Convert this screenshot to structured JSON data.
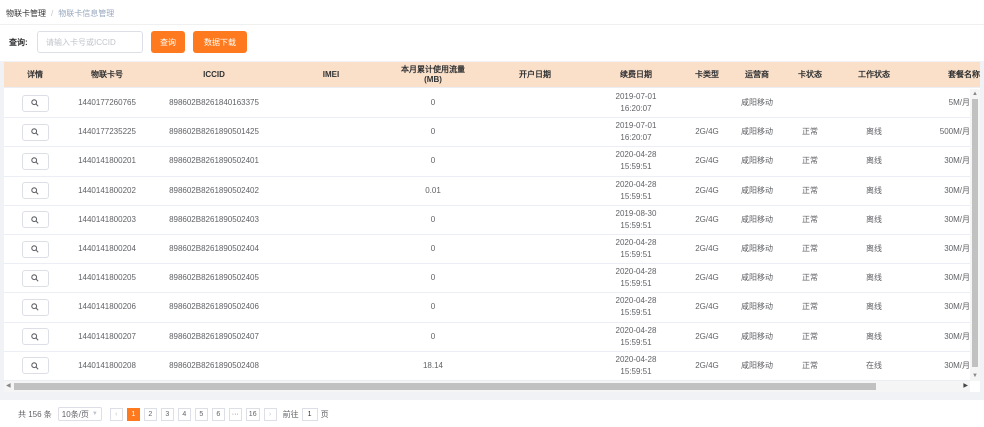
{
  "breadcrumb": {
    "items": [
      "物联卡管理",
      "物联卡信息管理"
    ],
    "separator": "/"
  },
  "search": {
    "label": "查询:",
    "placeholder": "请输入卡号或ICCID",
    "query_button": "查询",
    "download_button": "数据下载"
  },
  "colors": {
    "accent": "#ff7a1e",
    "header_bg": "#fae0c9"
  },
  "table": {
    "columns": [
      "详情",
      "物联卡号",
      "ICCID",
      "IMEI",
      "本月累计使用流量\n(MB)",
      "开户日期",
      "续费日期",
      "卡类型",
      "运营商",
      "卡状态",
      "工作状态",
      "套餐名称"
    ],
    "detail_icon": "search-icon",
    "rows": [
      {
        "card": "1440177260765",
        "iccid": "898602B8261840163375",
        "imei": "",
        "usage": "0",
        "open_date": "",
        "renew_date": "2019-07-01 16:20:07",
        "card_type": "",
        "operator": "咸阳移动",
        "card_status": "",
        "work_status": "",
        "package": "5M/月"
      },
      {
        "card": "1440177235225",
        "iccid": "898602B8261890501425",
        "imei": "",
        "usage": "0",
        "open_date": "",
        "renew_date": "2019-07-01 16:20:07",
        "card_type": "2G/4G",
        "operator": "咸阳移动",
        "card_status": "正常",
        "work_status": "离线",
        "package": "500M/月"
      },
      {
        "card": "1440141800201",
        "iccid": "898602B8261890502401",
        "imei": "",
        "usage": "0",
        "open_date": "",
        "renew_date": "2020-04-28 15:59:51",
        "card_type": "2G/4G",
        "operator": "咸阳移动",
        "card_status": "正常",
        "work_status": "离线",
        "package": "30M/月"
      },
      {
        "card": "1440141800202",
        "iccid": "898602B8261890502402",
        "imei": "",
        "usage": "0.01",
        "open_date": "",
        "renew_date": "2020-04-28 15:59:51",
        "card_type": "2G/4G",
        "operator": "咸阳移动",
        "card_status": "正常",
        "work_status": "离线",
        "package": "30M/月"
      },
      {
        "card": "1440141800203",
        "iccid": "898602B8261890502403",
        "imei": "",
        "usage": "0",
        "open_date": "",
        "renew_date": "2019-08-30 15:59:51",
        "card_type": "2G/4G",
        "operator": "咸阳移动",
        "card_status": "正常",
        "work_status": "离线",
        "package": "30M/月"
      },
      {
        "card": "1440141800204",
        "iccid": "898602B8261890502404",
        "imei": "",
        "usage": "0",
        "open_date": "",
        "renew_date": "2020-04-28 15:59:51",
        "card_type": "2G/4G",
        "operator": "咸阳移动",
        "card_status": "正常",
        "work_status": "离线",
        "package": "30M/月"
      },
      {
        "card": "1440141800205",
        "iccid": "898602B8261890502405",
        "imei": "",
        "usage": "0",
        "open_date": "",
        "renew_date": "2020-04-28 15:59:51",
        "card_type": "2G/4G",
        "operator": "咸阳移动",
        "card_status": "正常",
        "work_status": "离线",
        "package": "30M/月"
      },
      {
        "card": "1440141800206",
        "iccid": "898602B8261890502406",
        "imei": "",
        "usage": "0",
        "open_date": "",
        "renew_date": "2020-04-28 15:59:51",
        "card_type": "2G/4G",
        "operator": "咸阳移动",
        "card_status": "正常",
        "work_status": "离线",
        "package": "30M/月"
      },
      {
        "card": "1440141800207",
        "iccid": "898602B8261890502407",
        "imei": "",
        "usage": "0",
        "open_date": "",
        "renew_date": "2020-04-28 15:59:51",
        "card_type": "2G/4G",
        "operator": "咸阳移动",
        "card_status": "正常",
        "work_status": "离线",
        "package": "30M/月"
      },
      {
        "card": "1440141800208",
        "iccid": "898602B8261890502408",
        "imei": "",
        "usage": "18.14",
        "open_date": "",
        "renew_date": "2020-04-28 15:59:51",
        "card_type": "2G/4G",
        "operator": "咸阳移动",
        "card_status": "正常",
        "work_status": "在线",
        "package": "30M/月"
      }
    ]
  },
  "pagination": {
    "total": "共 156 条",
    "page_size": "10条/页",
    "pages": [
      "1",
      "2",
      "3",
      "4",
      "5",
      "6",
      "···",
      "16"
    ],
    "current": "1",
    "prev": "‹",
    "next": "›",
    "goto_label": "前往",
    "goto_value": "1",
    "goto_suffix": "页"
  }
}
